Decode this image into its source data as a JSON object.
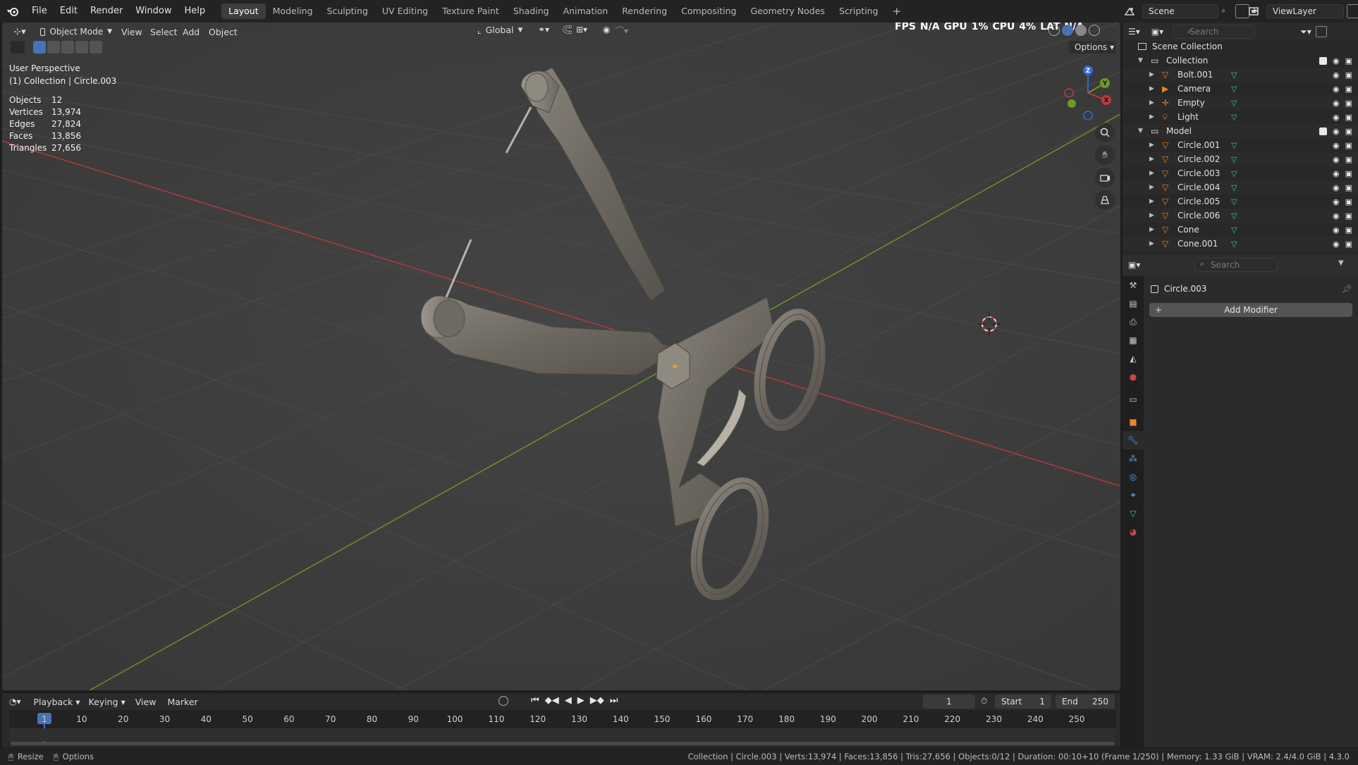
{
  "topbar": {
    "menus": [
      "File",
      "Edit",
      "Render",
      "Window",
      "Help"
    ],
    "workspaces": [
      "Layout",
      "Modeling",
      "Sculpting",
      "UV Editing",
      "Texture Paint",
      "Shading",
      "Animation",
      "Rendering",
      "Compositing",
      "Geometry Nodes",
      "Scripting"
    ],
    "active_workspace": "Layout",
    "add_workspace": "+",
    "scene": "Scene",
    "view_layer": "ViewLayer"
  },
  "viewport_header": {
    "mode": "Object Mode",
    "menus": [
      "View",
      "Select",
      "Add",
      "Object"
    ],
    "orientation": "Global",
    "options": "Options",
    "perf": {
      "fps_label": "FPS",
      "fps": "N/A",
      "gpu_label": "GPU",
      "gpu": "1%",
      "cpu_label": "CPU",
      "cpu": "4%",
      "lat_label": "LAT",
      "lat": "N/A"
    }
  },
  "overlay": {
    "view_name": "User Perspective",
    "context": "(1) Collection | Circle.003",
    "stats": [
      {
        "label": "Objects",
        "value": "12"
      },
      {
        "label": "Vertices",
        "value": "13,974"
      },
      {
        "label": "Edges",
        "value": "27,824"
      },
      {
        "label": "Faces",
        "value": "13,856"
      },
      {
        "label": "Triangles",
        "value": "27,656"
      }
    ]
  },
  "gizmo": {
    "x": "X",
    "y": "Y",
    "z": "Z"
  },
  "outliner": {
    "search_placeholder": "Search",
    "root": "Scene Collection",
    "items": [
      {
        "name": "Collection",
        "kind": "collection",
        "indent": 1
      },
      {
        "name": "Bolt.001",
        "kind": "mesh",
        "indent": 2
      },
      {
        "name": "Camera",
        "kind": "camera",
        "indent": 2
      },
      {
        "name": "Empty",
        "kind": "empty",
        "indent": 2
      },
      {
        "name": "Light",
        "kind": "light",
        "indent": 2
      },
      {
        "name": "Model",
        "kind": "collection",
        "indent": 1
      },
      {
        "name": "Circle.001",
        "kind": "mesh",
        "indent": 2
      },
      {
        "name": "Circle.002",
        "kind": "mesh",
        "indent": 2
      },
      {
        "name": "Circle.003",
        "kind": "mesh",
        "indent": 2
      },
      {
        "name": "Circle.004",
        "kind": "mesh",
        "indent": 2
      },
      {
        "name": "Circle.005",
        "kind": "mesh",
        "indent": 2
      },
      {
        "name": "Circle.006",
        "kind": "mesh",
        "indent": 2
      },
      {
        "name": "Cone",
        "kind": "mesh",
        "indent": 2
      },
      {
        "name": "Cone.001",
        "kind": "mesh",
        "indent": 2
      }
    ]
  },
  "properties": {
    "search_placeholder": "Search",
    "object_name": "Circle.003",
    "add_modifier": "Add Modifier"
  },
  "timeline": {
    "menus": [
      "Playback",
      "Keying",
      "View",
      "Marker"
    ],
    "current_frame": "1",
    "start_label": "Start",
    "start": "1",
    "end_label": "End",
    "end": "250",
    "ticks": [
      "1",
      "10",
      "20",
      "30",
      "40",
      "50",
      "60",
      "70",
      "80",
      "90",
      "100",
      "110",
      "120",
      "130",
      "140",
      "150",
      "160",
      "170",
      "180",
      "190",
      "200",
      "210",
      "220",
      "230",
      "240",
      "250"
    ]
  },
  "statusbar": {
    "left_items": [
      "Resize",
      "Options"
    ],
    "right": "Collection | Circle.003 | Verts:13,974 | Faces:13,856 | Tris:27,656 | Objects:0/12 | Duration: 00:10+10 (Frame 1/250) | Memory: 1.33 GiB | VRAM: 2.4/4.0 GiB | 4.3.0"
  },
  "colors": {
    "accent": "#4772b3",
    "x_axis": "#c0393b",
    "y_axis": "#6b9a23",
    "selected_row": "#334d80",
    "active_modifier_tab": "#5b9cf2"
  }
}
